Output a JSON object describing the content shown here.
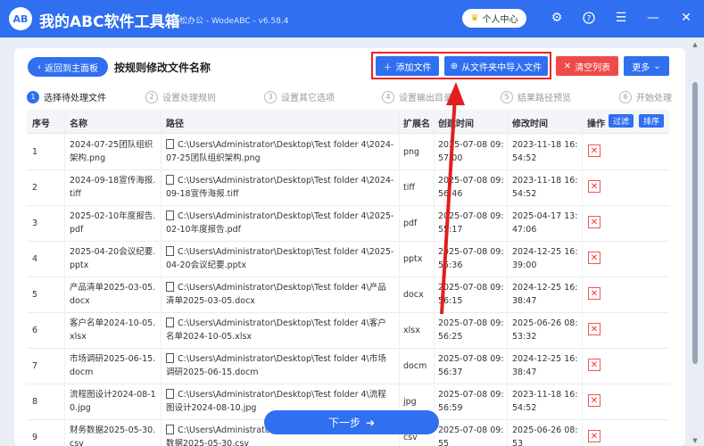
{
  "app": {
    "logo": "AB",
    "title": "我的ABC软件工具箱",
    "subtitle": "轻松办公 - WodeABC - v6.58.4",
    "user_center": "个人中心"
  },
  "header": {
    "back": "返回到主面板",
    "page_title": "按规则修改文件名称",
    "add_file": "添加文件",
    "import_folder": "从文件夹中导入文件",
    "clear_list": "清空列表",
    "more": "更多"
  },
  "steps": [
    {
      "num": "1",
      "label": "选择待处理文件"
    },
    {
      "num": "2",
      "label": "设置处理规则"
    },
    {
      "num": "3",
      "label": "设置其它选项"
    },
    {
      "num": "4",
      "label": "设置输出目录"
    },
    {
      "num": "5",
      "label": "结果路径预览"
    },
    {
      "num": "6",
      "label": "开始处理"
    }
  ],
  "table": {
    "headers": {
      "index": "序号",
      "name": "名称",
      "path": "路径",
      "ext": "扩展名",
      "created": "创建时间",
      "modified": "修改时间",
      "action": "操作",
      "filter": "过滤",
      "sort": "排序"
    },
    "rows": [
      {
        "index": "1",
        "name": "2024-07-25团队组织架构.png",
        "path": "C:\\Users\\Administrator\\Desktop\\Test folder 4\\2024-07-25团队组织架构.png",
        "ext": "png",
        "created": "2025-07-08 09:57:00",
        "modified": "2023-11-18 16:54:52"
      },
      {
        "index": "2",
        "name": "2024-09-18宣传海报.tiff",
        "path": "C:\\Users\\Administrator\\Desktop\\Test folder 4\\2024-09-18宣传海报.tiff",
        "ext": "tiff",
        "created": "2025-07-08 09:56:46",
        "modified": "2023-11-18 16:54:52"
      },
      {
        "index": "3",
        "name": "2025-02-10年度报告.pdf",
        "path": "C:\\Users\\Administrator\\Desktop\\Test folder 4\\2025-02-10年度报告.pdf",
        "ext": "pdf",
        "created": "2025-07-08 09:55:17",
        "modified": "2025-04-17 13:47:06"
      },
      {
        "index": "4",
        "name": "2025-04-20会议纪要.pptx",
        "path": "C:\\Users\\Administrator\\Desktop\\Test folder 4\\2025-04-20会议纪要.pptx",
        "ext": "pptx",
        "created": "2025-07-08 09:55:36",
        "modified": "2024-12-25 16:39:00"
      },
      {
        "index": "5",
        "name": "产品清单2025-03-05.docx",
        "path": "C:\\Users\\Administrator\\Desktop\\Test folder 4\\产品清单2025-03-05.docx",
        "ext": "docx",
        "created": "2025-07-08 09:56:15",
        "modified": "2024-12-25 16:38:47"
      },
      {
        "index": "6",
        "name": "客户名单2024-10-05.xlsx",
        "path": "C:\\Users\\Administrator\\Desktop\\Test folder 4\\客户名单2024-10-05.xlsx",
        "ext": "xlsx",
        "created": "2025-07-08 09:56:25",
        "modified": "2025-06-26 08:53:32"
      },
      {
        "index": "7",
        "name": "市场调研2025-06-15.docm",
        "path": "C:\\Users\\Administrator\\Desktop\\Test folder 4\\市场调研2025-06-15.docm",
        "ext": "docm",
        "created": "2025-07-08 09:56:37",
        "modified": "2024-12-25 16:38:47"
      },
      {
        "index": "8",
        "name": "流程图设计2024-08-10.jpg",
        "path": "C:\\Users\\Administrator\\Desktop\\Test folder 4\\流程图设计2024-08-10.jpg",
        "ext": "jpg",
        "created": "2025-07-08 09:56:59",
        "modified": "2023-11-18 16:54:52"
      },
      {
        "index": "9",
        "name": "财务数据2025-05-30.csv",
        "path": "C:\\Users\\Administrator\\Desktop\\Test folder 4\\财务数据2025-05-30.csv",
        "ext": "csv",
        "created": "2025-07-08 09:55",
        "modified": "2025-06-26 08:53"
      }
    ]
  },
  "footer": {
    "next": "下一步"
  }
}
